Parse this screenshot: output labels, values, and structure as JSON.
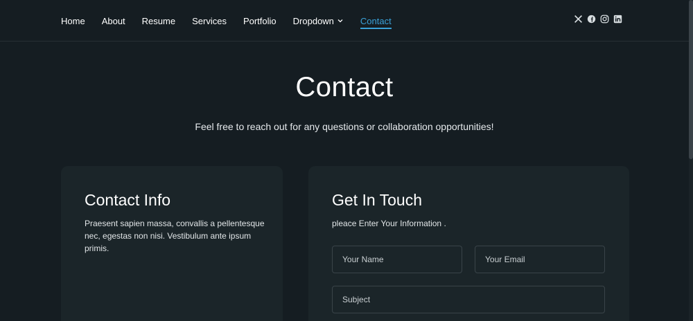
{
  "nav": {
    "items": [
      {
        "label": "Home"
      },
      {
        "label": "About"
      },
      {
        "label": "Resume"
      },
      {
        "label": "Services"
      },
      {
        "label": "Portfolio"
      },
      {
        "label": "Dropdown"
      },
      {
        "label": "Contact"
      }
    ],
    "active": "Contact",
    "accent_color": "#3aa1d8"
  },
  "socials": [
    "x-icon",
    "facebook-icon",
    "instagram-icon",
    "linkedin-icon"
  ],
  "hero": {
    "title": "Contact",
    "subtitle": "Feel free to reach out for any questions or collaboration opportunities!"
  },
  "contact_info": {
    "heading": "Contact Info",
    "text": "Praesent sapien massa, convallis a pellentesque nec, egestas non nisi. Vestibulum ante ipsum primis."
  },
  "get_in_touch": {
    "heading": "Get In Touch",
    "subtitle": "pleace Enter Your Information .",
    "fields": {
      "name_placeholder": "Your Name",
      "email_placeholder": "Your Email",
      "subject_placeholder": "Subject"
    }
  }
}
